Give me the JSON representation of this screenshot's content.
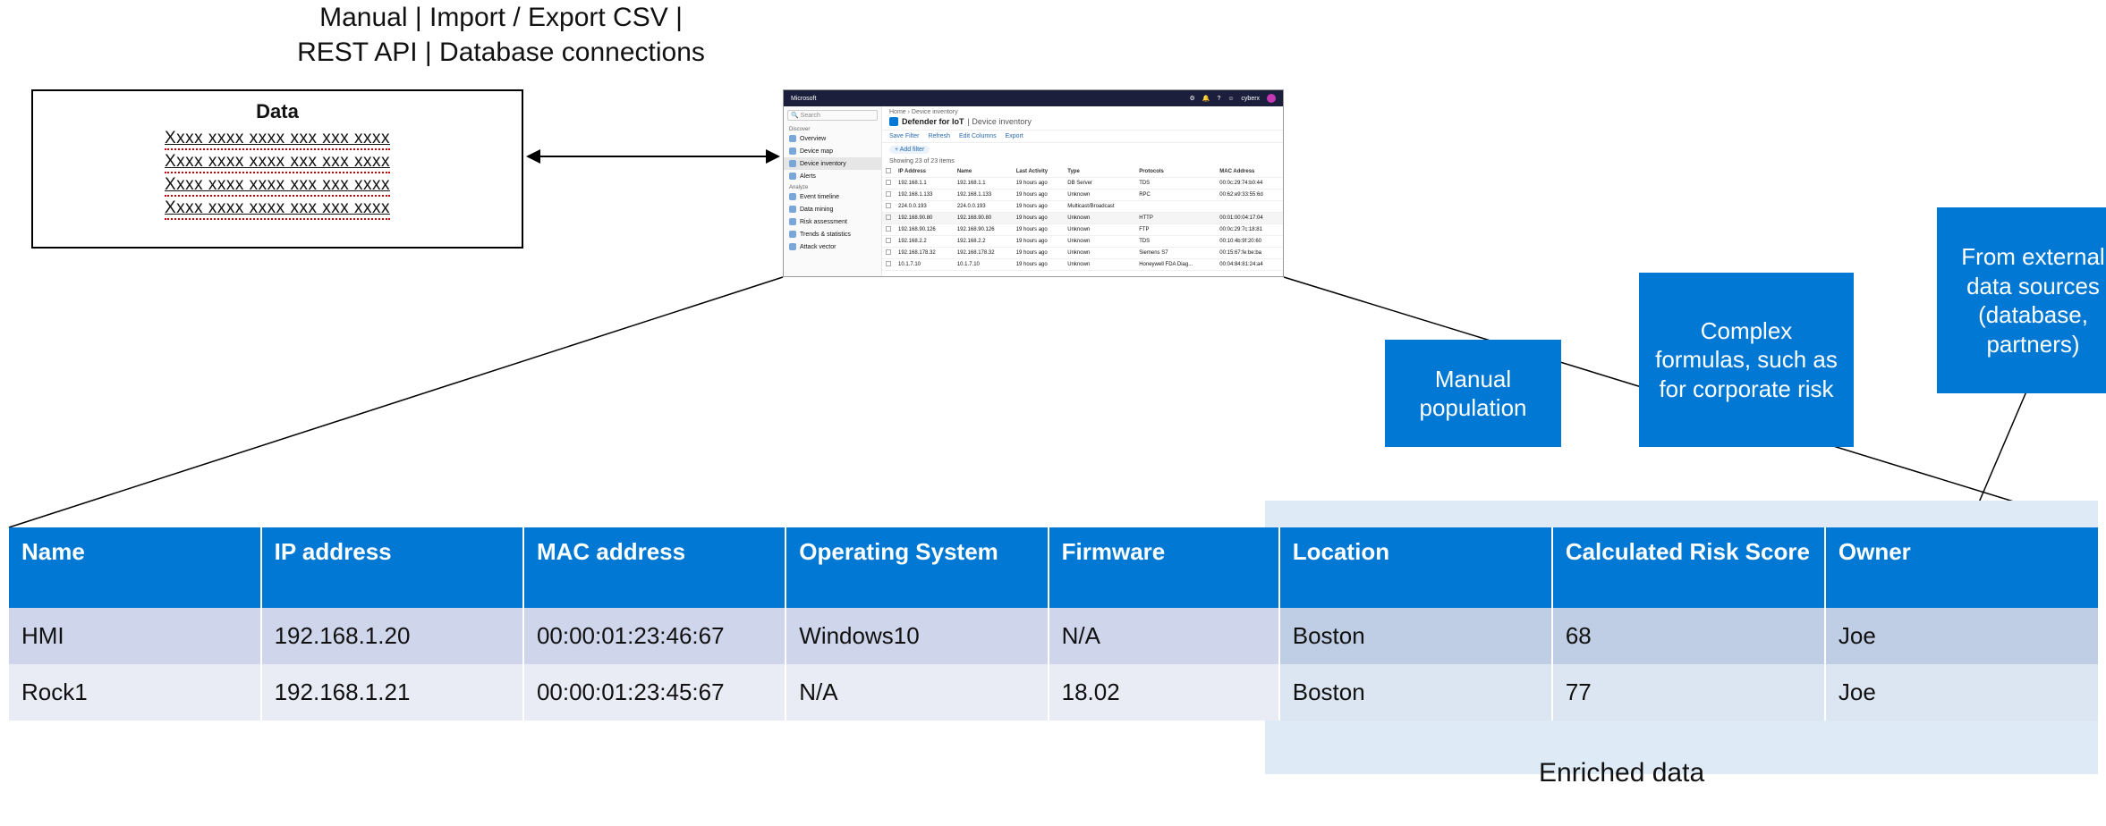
{
  "top_caption_line1": "Manual | Import / Export CSV |",
  "top_caption_line2": "REST API | Database connections",
  "data_box": {
    "title": "Data",
    "lines": [
      "Xxxx xxxx xxxx xxx xxx xxxx",
      "Xxxx xxxx xxxx xxx xxx xxxx",
      "Xxxx xxxx xxxx xxx xxx xxxx",
      "Xxxx xxxx xxxx xxx xxx xxxx"
    ]
  },
  "mini": {
    "brand": "Microsoft",
    "user": "cyberx",
    "breadcrumb": "Home  ›  Device inventory",
    "product_title": "Defender for IoT",
    "page_title": "Device inventory",
    "search_placeholder": "Search",
    "side_group1": "Discover",
    "side_group2": "Analyze",
    "side_items1": [
      "Overview",
      "Device map",
      "Device inventory",
      "Alerts"
    ],
    "side_items2": [
      "Event timeline",
      "Data mining",
      "Risk assessment",
      "Trends & statistics",
      "Attack vector"
    ],
    "toolbar": [
      "Save Filter",
      "Refresh",
      "Edit Columns",
      "Export"
    ],
    "add_filter": "+ Add filter",
    "count_text": "Showing 23 of 23 items",
    "columns": [
      "",
      "IP Address",
      "Name",
      "Last Activity",
      "Type",
      "Protocols",
      "MAC Address"
    ],
    "rows": [
      [
        "",
        "192.168.1.1",
        "192.168.1.1",
        "19 hours ago",
        "DB Server",
        "TDS",
        "00:0c:29:74:b0:44"
      ],
      [
        "",
        "192.168.1.133",
        "192.168.1.133",
        "19 hours ago",
        "Unknown",
        "RPC",
        "00:62:e9:33:55:6d"
      ],
      [
        "",
        "224.0.0.193",
        "224.0.0.193",
        "19 hours ago",
        "Multicast/Broadcast",
        "",
        ""
      ],
      [
        "",
        "192.168.90.80",
        "192.168.90.80",
        "19 hours ago",
        "Unknown",
        "HTTP",
        "00:01:00:04:17:04"
      ],
      [
        "",
        "192.168.90.126",
        "192.168.90.126",
        "19 hours ago",
        "Unknown",
        "FTP",
        "00:0c:29:7c:18:81"
      ],
      [
        "",
        "192.168.2.2",
        "192.168.2.2",
        "19 hours ago",
        "Unknown",
        "TDS",
        "00:10:4b:9f:20:60"
      ],
      [
        "",
        "192.168.178.32",
        "192.168.178.32",
        "19 hours ago",
        "Unknown",
        "Siemens S7",
        "00:15:67:fe:be:ba"
      ],
      [
        "",
        "10.1.7.10",
        "10.1.7.10",
        "19 hours ago",
        "Unknown",
        "Honeywell FDA Diag...",
        "00:04:84:81:24:a4"
      ]
    ]
  },
  "callouts": {
    "manual": "Manual population",
    "formulas": "Complex formulas, such as for corporate risk",
    "external": "From external data sources (database, partners)"
  },
  "table": {
    "headers": [
      "Name",
      "IP address",
      "MAC address",
      "Operating System",
      "Firmware",
      "Location",
      "Calculated Risk Score",
      "Owner"
    ],
    "rows": [
      [
        "HMI",
        "192.168.1.20",
        "00:00:01:23:46:67",
        "Windows10",
        "N/A",
        "Boston",
        "68",
        "Joe"
      ],
      [
        "Rock1",
        "192.168.1.21",
        "00:00:01:23:45:67",
        "N/A",
        "18.02",
        "Boston",
        "77",
        "Joe"
      ]
    ]
  },
  "enriched_label": "Enriched data",
  "chart_data": {
    "type": "table",
    "title": "Device inventory with enriched data",
    "columns": [
      "Name",
      "IP address",
      "MAC address",
      "Operating System",
      "Firmware",
      "Location",
      "Calculated Risk Score",
      "Owner"
    ],
    "rows": [
      [
        "HMI",
        "192.168.1.20",
        "00:00:01:23:46:67",
        "Windows10",
        "N/A",
        "Boston",
        68,
        "Joe"
      ],
      [
        "Rock1",
        "192.168.1.21",
        "00:00:01:23:45:67",
        "N/A",
        "18.02",
        "Boston",
        77,
        "Joe"
      ]
    ],
    "enriched_columns": [
      "Location",
      "Calculated Risk Score",
      "Owner"
    ],
    "enrichment_sources": {
      "Location": "Manual population",
      "Calculated Risk Score": "Complex formulas, such as for corporate risk",
      "Owner": "From external data sources (database, partners)"
    },
    "data_flow_methods": [
      "Manual",
      "Import / Export CSV",
      "REST API",
      "Database connections"
    ]
  }
}
